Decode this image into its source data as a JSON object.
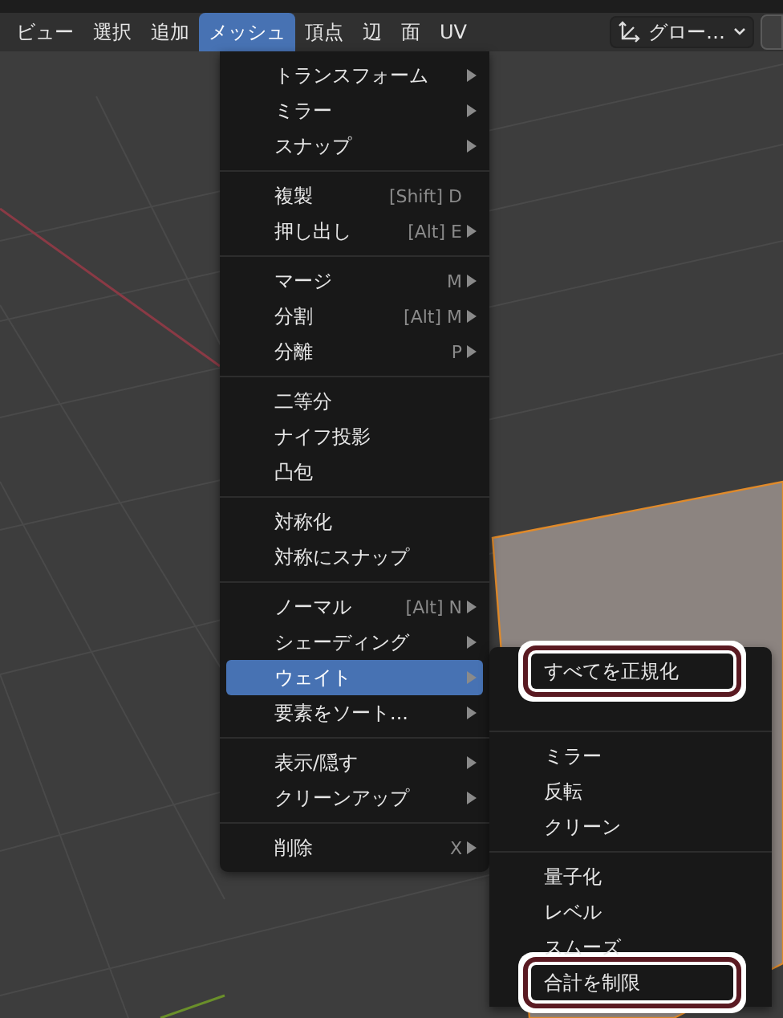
{
  "header": {
    "menus": [
      {
        "label": "ビュー",
        "selected": false
      },
      {
        "label": "選択",
        "selected": false
      },
      {
        "label": "追加",
        "selected": false
      },
      {
        "label": "メッシュ",
        "selected": true
      },
      {
        "label": "頂点",
        "selected": false
      },
      {
        "label": "辺",
        "selected": false
      },
      {
        "label": "面",
        "selected": false
      },
      {
        "label": "UV",
        "selected": false
      }
    ],
    "orientation_dropdown": {
      "value": "グロー…"
    }
  },
  "mesh_menu": {
    "items": [
      {
        "kind": "item",
        "label": "トランスフォーム",
        "submenu": true,
        "selected": false
      },
      {
        "kind": "item",
        "label": "ミラー",
        "submenu": true,
        "selected": false
      },
      {
        "kind": "item",
        "label": "スナップ",
        "submenu": true,
        "selected": false
      },
      {
        "kind": "separator"
      },
      {
        "kind": "item",
        "label": "複製",
        "shortcut": "[Shift] D",
        "submenu": false,
        "selected": false
      },
      {
        "kind": "item",
        "label": "押し出し",
        "shortcut": "[Alt] E",
        "submenu": true,
        "selected": false
      },
      {
        "kind": "separator"
      },
      {
        "kind": "item",
        "label": "マージ",
        "shortcut": "M",
        "submenu": true,
        "selected": false
      },
      {
        "kind": "item",
        "label": "分割",
        "shortcut": "[Alt] M",
        "submenu": true,
        "selected": false
      },
      {
        "kind": "item",
        "label": "分離",
        "shortcut": "P",
        "submenu": true,
        "selected": false
      },
      {
        "kind": "separator"
      },
      {
        "kind": "item",
        "label": "二等分",
        "submenu": false,
        "selected": false
      },
      {
        "kind": "item",
        "label": "ナイフ投影",
        "submenu": false,
        "selected": false
      },
      {
        "kind": "item",
        "label": "凸包",
        "submenu": false,
        "selected": false
      },
      {
        "kind": "separator"
      },
      {
        "kind": "item",
        "label": "対称化",
        "submenu": false,
        "selected": false
      },
      {
        "kind": "item",
        "label": "対称にスナップ",
        "submenu": false,
        "selected": false
      },
      {
        "kind": "separator"
      },
      {
        "kind": "item",
        "label": "ノーマル",
        "shortcut": "[Alt] N",
        "submenu": true,
        "selected": false
      },
      {
        "kind": "item",
        "label": "シェーディング",
        "submenu": true,
        "selected": false
      },
      {
        "kind": "item",
        "label": "ウェイト",
        "submenu": true,
        "selected": true
      },
      {
        "kind": "item",
        "label": "要素をソート...",
        "submenu": true,
        "selected": false
      },
      {
        "kind": "separator"
      },
      {
        "kind": "item",
        "label": "表示/隠す",
        "submenu": true,
        "selected": false
      },
      {
        "kind": "item",
        "label": "クリーンアップ",
        "submenu": true,
        "selected": false
      },
      {
        "kind": "separator"
      },
      {
        "kind": "item",
        "label": "削除",
        "shortcut": "X",
        "submenu": true,
        "selected": false
      }
    ]
  },
  "weight_submenu": {
    "items": [
      {
        "kind": "item",
        "label": "すべてを正規化",
        "highlighted": true
      },
      {
        "kind": "hidden"
      },
      {
        "kind": "separator"
      },
      {
        "kind": "item",
        "label": "ミラー",
        "highlighted": false
      },
      {
        "kind": "item",
        "label": "反転",
        "highlighted": false
      },
      {
        "kind": "item",
        "label": "クリーン",
        "highlighted": false
      },
      {
        "kind": "separator"
      },
      {
        "kind": "item",
        "label": "量子化",
        "highlighted": false
      },
      {
        "kind": "item",
        "label": "レベル",
        "highlighted": false
      },
      {
        "kind": "item",
        "label": "スムーズ",
        "highlighted": false
      },
      {
        "kind": "item",
        "label": "合計を制限",
        "highlighted": true
      }
    ]
  }
}
